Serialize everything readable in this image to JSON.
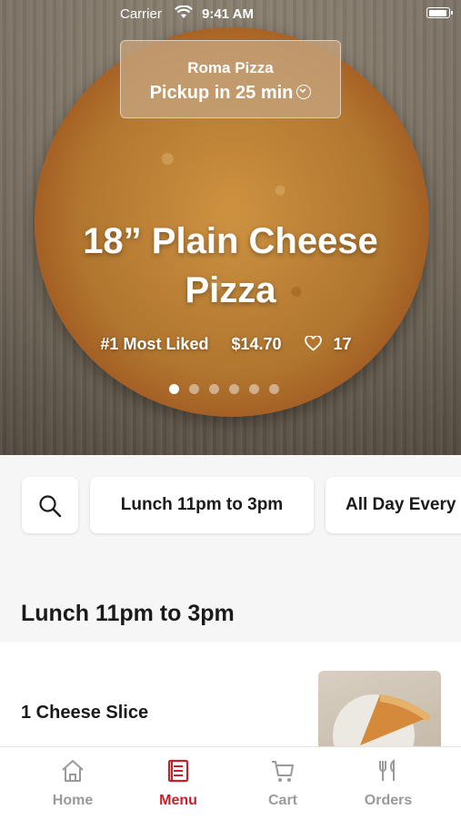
{
  "status_bar": {
    "carrier": "Carrier",
    "time": "9:41 AM"
  },
  "store": {
    "name": "Roma Pizza",
    "pickup": "Pickup in 25 min"
  },
  "featured": {
    "title": "18” Plain Cheese Pizza",
    "badge": "#1 Most Liked",
    "price": "$14.70",
    "likes": "17",
    "slide_count": 6,
    "active_slide": 1
  },
  "filters": {
    "search_icon": "search-icon",
    "chips": [
      "Lunch 11pm to 3pm",
      "All Day Every"
    ]
  },
  "section": {
    "title": "Lunch 11pm to 3pm"
  },
  "items": [
    {
      "name": "1 Cheese Slice"
    }
  ],
  "tabs": [
    {
      "label": "Home",
      "icon": "home-icon",
      "active": false
    },
    {
      "label": "Menu",
      "icon": "menu-icon",
      "active": true
    },
    {
      "label": "Cart",
      "icon": "cart-icon",
      "active": false
    },
    {
      "label": "Orders",
      "icon": "orders-icon",
      "active": false
    }
  ],
  "colors": {
    "accent": "#c8202a",
    "inactive_tab": "#9a9a9a"
  }
}
